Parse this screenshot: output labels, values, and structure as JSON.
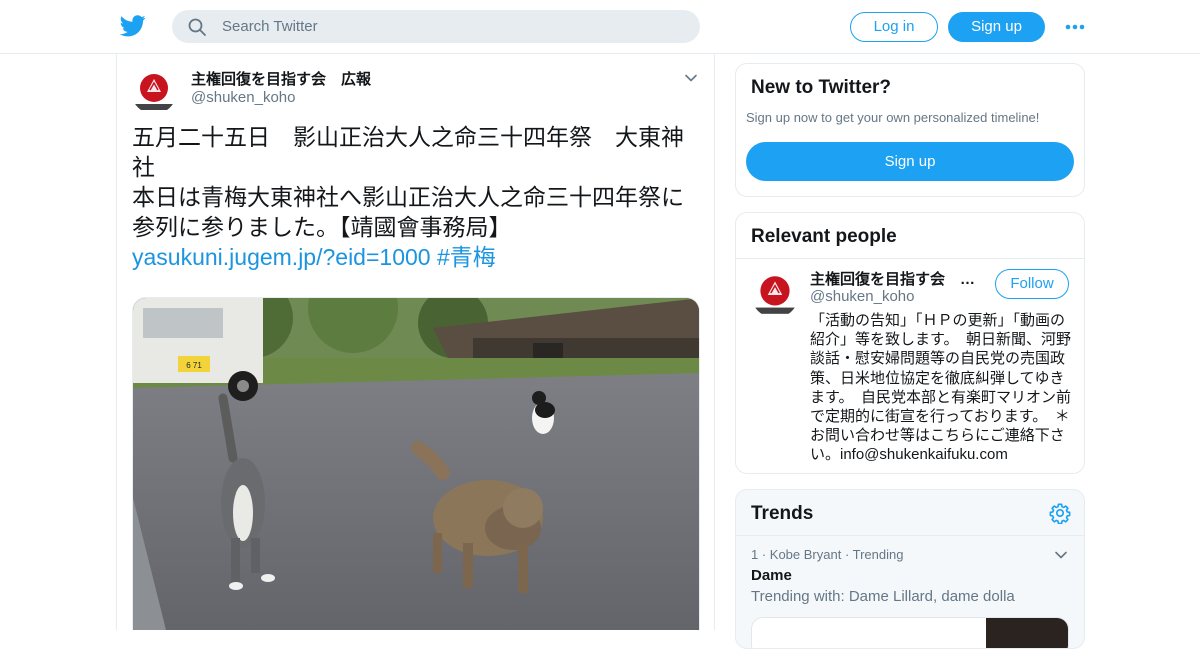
{
  "topbar": {
    "logo_icon": "twitter-bird-icon",
    "search_placeholder": "Search Twitter",
    "login_label": "Log in",
    "signup_label": "Sign up",
    "more_icon": "more-dots-icon",
    "accent": "#1da1f2"
  },
  "tweet": {
    "author_name": "主権回復を目指す会　広報",
    "author_handle": "@shuken_koho",
    "lines": [
      "五月二十五日　影山正治大人之命三十四年祭　大東神",
      "社",
      "本日は青梅大東神社へ影山正治大人之命三十四年祭に",
      "参列に参りました。【靖國會事務局】"
    ],
    "link": "yasukuni.jugem.jp/?eid=1000",
    "hashtag": "#青梅",
    "photo_icon": "tweet-photo-cats",
    "truck_plate": "6 71"
  },
  "new_to_twitter": {
    "title": "New to Twitter?",
    "subtitle": "Sign up now to get your own personalized timeline!",
    "signup_label": "Sign up"
  },
  "relevant_people": {
    "title": "Relevant people",
    "person": {
      "name": "主権回復を目指す会　…",
      "handle": "@shuken_koho",
      "follow_label": "Follow",
      "bio": "「活動の告知」「ＨＰの更新」「動画の紹介」等を致します。　朝日新聞、河野談話・慰安婦問題等の自民党の売国政策、日米地位協定を徹底糾弾してゆきます。　自民党本部と有楽町マリオン前で定期的に街宣を行っております。　＊お問い合わせ等はこちらにご連絡下さい。info@shukenkaifuku.com"
    }
  },
  "trends": {
    "title": "Trends",
    "items": [
      {
        "meta": "1 · Kobe Bryant · Trending",
        "name": "Dame",
        "with": "Trending with: Dame Lillard, dame dolla"
      }
    ]
  },
  "colors": {
    "link": "#1b95e0",
    "text": "#14171a",
    "muted": "#657786",
    "border": "#e6ecf0"
  }
}
